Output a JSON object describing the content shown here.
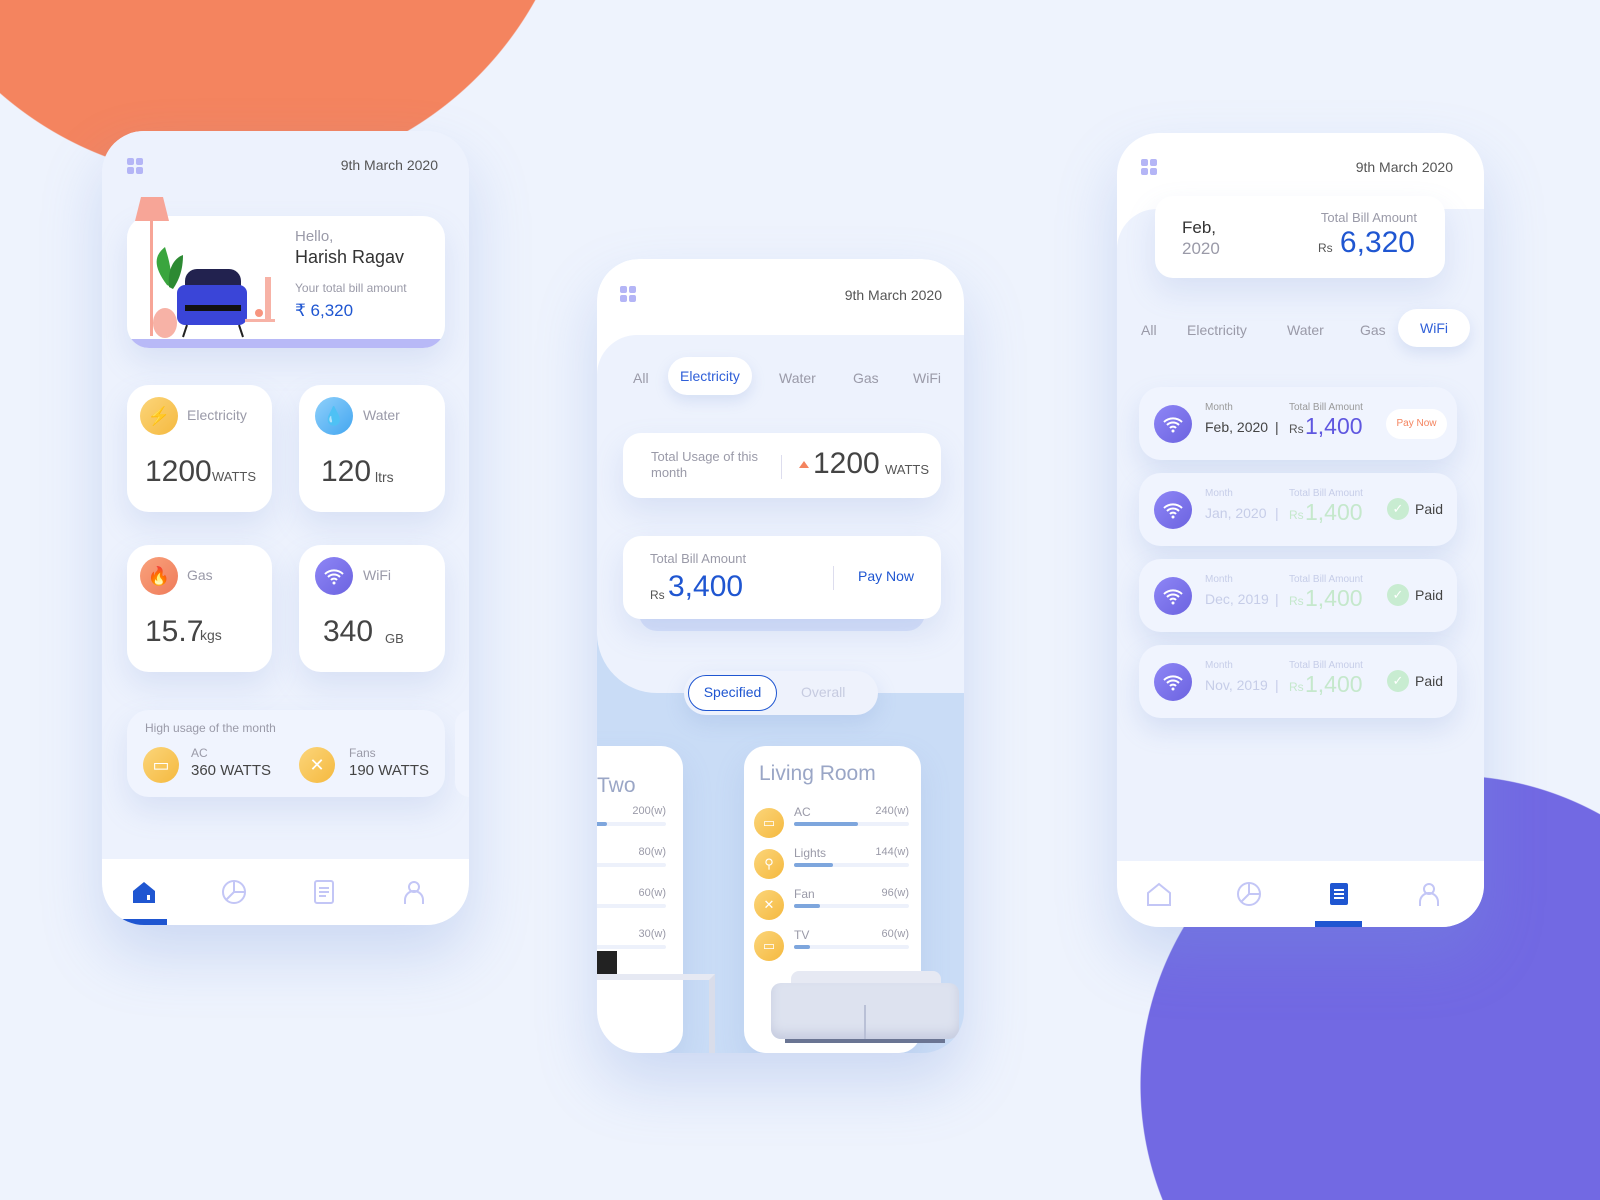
{
  "colors": {
    "accent": "#1f56d1",
    "orange": "#f4845f",
    "purple": "#7269e3",
    "paid_green": "#b9e6c4"
  },
  "home": {
    "date": "9th March 2020",
    "greeting": "Hello,",
    "name": "Harish Ragav",
    "bill_label": "Your total bill amount",
    "bill_amount": "₹ 6,320",
    "tiles": [
      {
        "label": "Electricity",
        "value": "1200",
        "unit": "WATTS",
        "icon": "lightning-icon"
      },
      {
        "label": "Water",
        "value": "120",
        "unit": "ltrs",
        "icon": "water-drop-icon"
      },
      {
        "label": "Gas",
        "value": "15.7",
        "unit": "kgs",
        "icon": "flame-icon"
      },
      {
        "label": "WiFi",
        "value": "340",
        "unit": "GB",
        "icon": "wifi-icon"
      }
    ],
    "high_usage": {
      "title": "High usage of the month",
      "items": [
        {
          "label": "AC",
          "value": "360 WATTS"
        },
        {
          "label": "Fans",
          "value": "190 WATTS"
        }
      ]
    },
    "nav": [
      "home-icon",
      "pie-chart-icon",
      "document-icon",
      "profile-icon"
    ],
    "active_nav": 0
  },
  "usage": {
    "date": "9th March 2020",
    "tabs": [
      "All",
      "Electricity",
      "Water",
      "Gas",
      "WiFi"
    ],
    "active_tab": "Electricity",
    "usage_label": "Total Usage of this month",
    "usage_value": "1200",
    "usage_unit": "WATTS",
    "bill_label": "Total Bill Amount",
    "currency": "Rs",
    "bill_amount": "3,400",
    "pay_now": "Pay Now",
    "toggle": [
      "Specified",
      "Overall"
    ],
    "rooms": [
      {
        "name": "Two",
        "items": [
          {
            "label": "",
            "watts": 200,
            "value": "200(w)"
          },
          {
            "label": "",
            "watts": 80,
            "value": "80(w)"
          },
          {
            "label": "",
            "watts": 60,
            "value": "60(w)"
          },
          {
            "label": "",
            "watts": 30,
            "value": "30(w)"
          }
        ]
      },
      {
        "name": "Living Room",
        "items": [
          {
            "label": "AC",
            "watts": 240,
            "value": "240(w)"
          },
          {
            "label": "Lights",
            "watts": 144,
            "value": "144(w)"
          },
          {
            "label": "Fan",
            "watts": 96,
            "value": "96(w)"
          },
          {
            "label": "TV",
            "watts": 60,
            "value": "60(w)"
          }
        ]
      }
    ]
  },
  "bills": {
    "date": "9th March 2020",
    "summary": {
      "month": "Feb,",
      "year": "2020",
      "label": "Total Bill Amount",
      "currency": "Rs",
      "amount": "6,320"
    },
    "tabs": [
      "All",
      "Electricity",
      "Water",
      "Gas",
      "WiFi"
    ],
    "active_tab": "WiFi",
    "month_label": "Month",
    "amount_label": "Total Bill Amount",
    "rows": [
      {
        "month": "Feb, 2020",
        "currency": "Rs",
        "amount": "1,400",
        "status": "Pay Now"
      },
      {
        "month": "Jan, 2020",
        "currency": "Rs",
        "amount": "1,400",
        "status": "Paid"
      },
      {
        "month": "Dec, 2019",
        "currency": "Rs",
        "amount": "1,400",
        "status": "Paid"
      },
      {
        "month": "Nov, 2019",
        "currency": "Rs",
        "amount": "1,400",
        "status": "Paid"
      }
    ],
    "active_nav": 2
  }
}
